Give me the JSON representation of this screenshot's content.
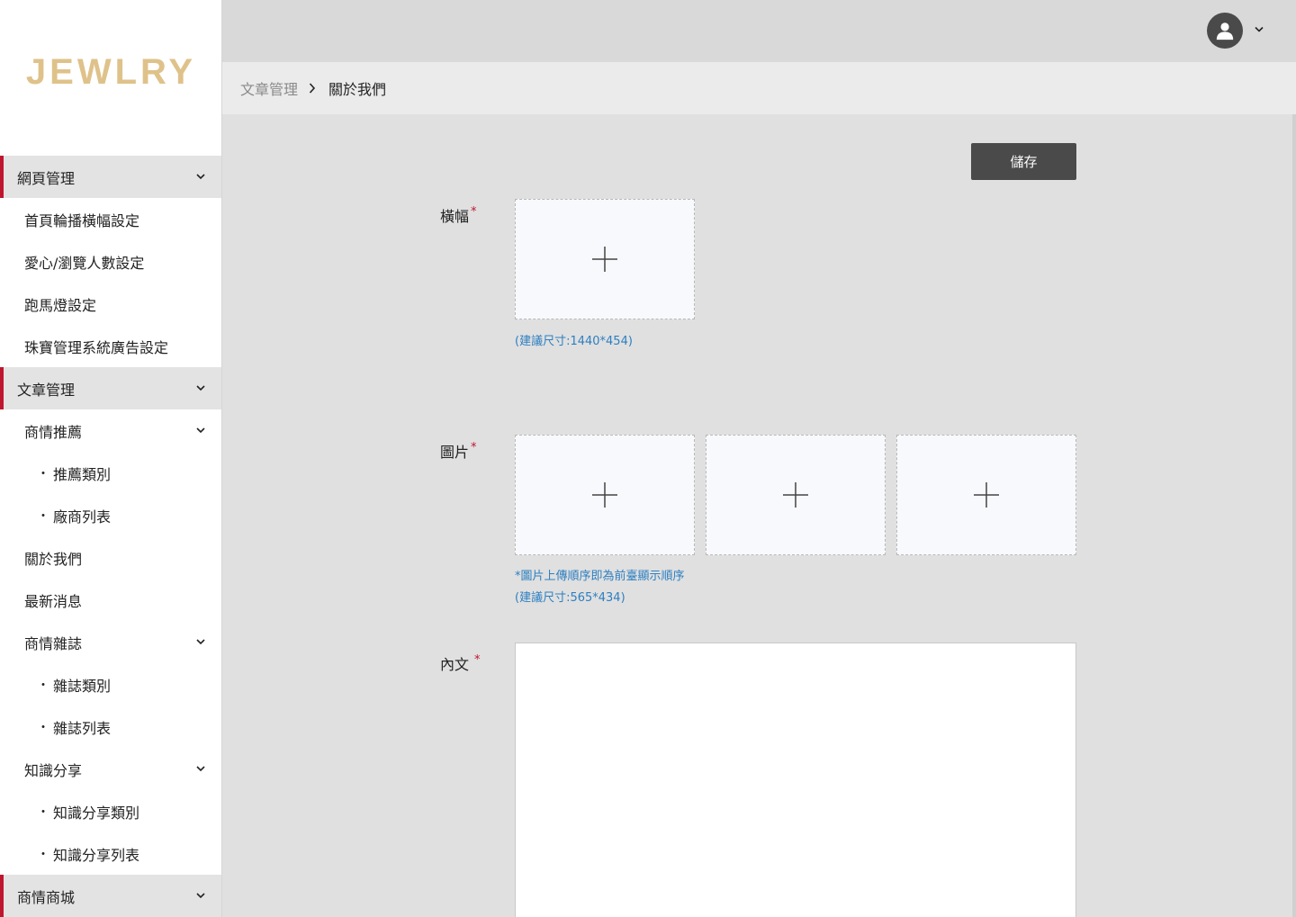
{
  "brand": {
    "logo": "JEWLRY",
    "color": "#dfc28a",
    "accent": "#c0152f"
  },
  "sidebar": {
    "items": [
      {
        "type": "group",
        "label": "網頁管理",
        "chevron": "chevron-down-icon"
      },
      {
        "type": "item",
        "label": "首頁輪播橫幅設定"
      },
      {
        "type": "item",
        "label": "愛心/瀏覽人數設定"
      },
      {
        "type": "item",
        "label": "跑馬燈設定"
      },
      {
        "type": "item",
        "label": "珠寶管理系統廣告設定"
      },
      {
        "type": "group",
        "label": "文章管理",
        "chevron": "chevron-down-icon"
      },
      {
        "type": "item",
        "label": "商情推薦",
        "chevron": "chevron-down-icon"
      },
      {
        "type": "sub",
        "label": "推薦類別"
      },
      {
        "type": "sub",
        "label": "廠商列表"
      },
      {
        "type": "item",
        "label": "關於我們"
      },
      {
        "type": "item",
        "label": "最新消息"
      },
      {
        "type": "item",
        "label": "商情雜誌",
        "chevron": "chevron-down-icon"
      },
      {
        "type": "sub",
        "label": "雜誌類別"
      },
      {
        "type": "sub",
        "label": "雜誌列表"
      },
      {
        "type": "item",
        "label": "知識分享",
        "chevron": "chevron-down-icon"
      },
      {
        "type": "sub",
        "label": "知識分享類別"
      },
      {
        "type": "sub",
        "label": "知識分享列表"
      },
      {
        "type": "group",
        "label": "商情商城",
        "chevron": "chevron-down-icon"
      }
    ],
    "sub_bullet": "・"
  },
  "header": {
    "avatar_icon": "user-avatar-icon"
  },
  "breadcrumb": {
    "parent": "文章管理",
    "current": "關於我們"
  },
  "form": {
    "save_label": "儲存",
    "banner": {
      "label": "橫幅",
      "required_mark": "*",
      "hint": "(建議尺寸:1440*454)"
    },
    "images": {
      "label": "圖片",
      "required_mark": "*",
      "hint_order": "*圖片上傳順序即為前臺顯示順序",
      "hint_size": "(建議尺寸:565*434)"
    },
    "content": {
      "label": "內文",
      "required_mark": "*"
    }
  }
}
